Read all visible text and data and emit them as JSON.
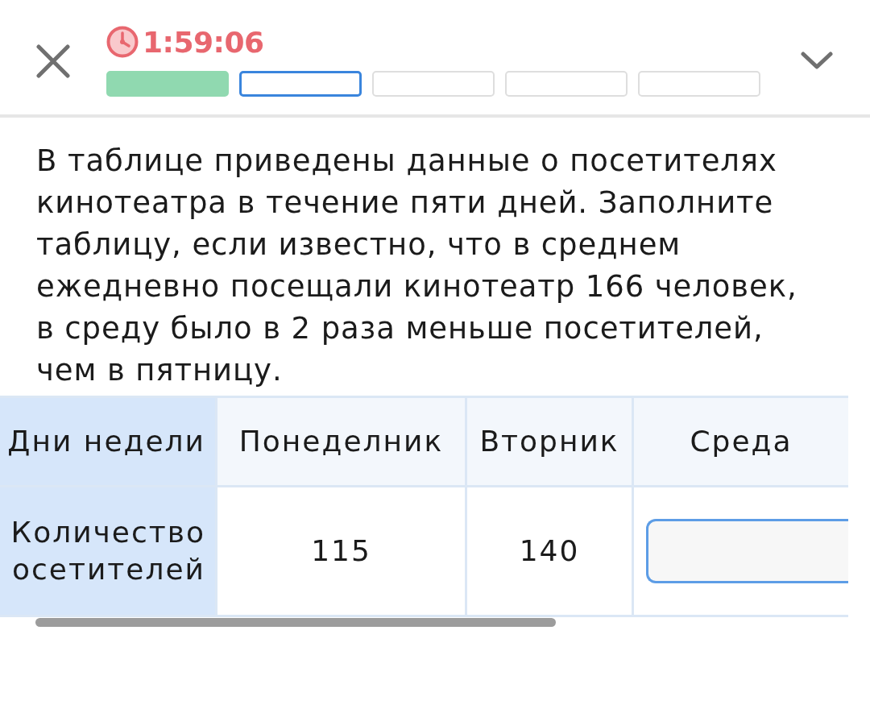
{
  "header": {
    "timer": "1:59:06",
    "progress": [
      {
        "completed": true,
        "selected": false
      },
      {
        "completed": false,
        "selected": true
      },
      {
        "completed": false,
        "selected": false
      },
      {
        "completed": false,
        "selected": false
      },
      {
        "completed": false,
        "selected": false
      }
    ]
  },
  "question": {
    "text": "В таблице приведены данные о посетителях кинотеатра в течение пяти дней. Заполните таблицу, если известно, что в среднем ежедневно посещали кинотеатр 166 человек, в среду было в 2 раза меньше посетителей, чем в пятницу."
  },
  "table": {
    "header": {
      "label": "Дни недели",
      "cells": [
        "Понеделник",
        "Вторник",
        "Среда"
      ]
    },
    "rows": [
      {
        "label": "Количество осетителей",
        "cells": [
          {
            "kind": "value",
            "text": "115"
          },
          {
            "kind": "value",
            "text": "140"
          },
          {
            "kind": "input"
          }
        ]
      }
    ]
  }
}
